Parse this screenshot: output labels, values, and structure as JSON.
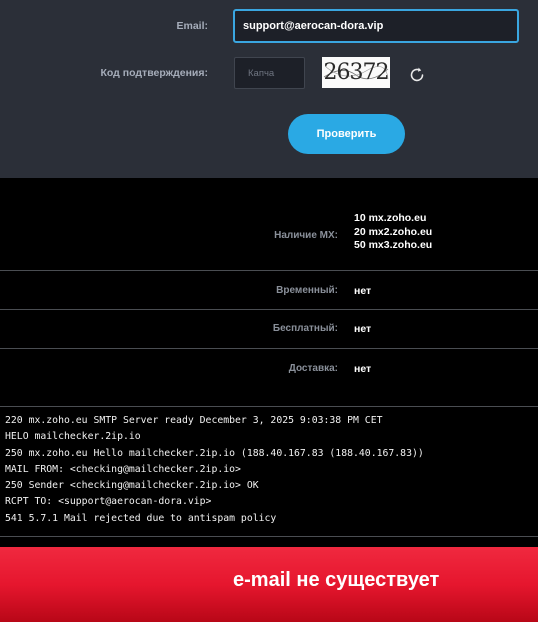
{
  "form": {
    "email_label": "Email:",
    "email_value": "support@aerocan-dora.vip",
    "code_label": "Код подтверждения:",
    "captcha_placeholder": "Капча",
    "captcha_text": "26372",
    "check_button": "Проверить"
  },
  "results": {
    "mx_label": "Наличие MX:",
    "mx_records": [
      "10 mx.zoho.eu",
      "20 mx2.zoho.eu",
      "50 mx3.zoho.eu"
    ],
    "temporary_label": "Временный:",
    "temporary_value": "нет",
    "free_label": "Бесплатный:",
    "free_value": "нет",
    "delivery_label": "Доставка:",
    "delivery_value": "нет"
  },
  "log": [
    "220 mx.zoho.eu SMTP Server ready December 3, 2025 9:03:38 PM CET",
    "HELO mailchecker.2ip.io",
    "250 mx.zoho.eu Hello mailchecker.2ip.io (188.40.167.83 (188.40.167.83))",
    "MAIL FROM: <checking@mailchecker.2ip.io>",
    "250 Sender <checking@mailchecker.2ip.io> OK",
    "RCPT TO: <support@aerocan-dora.vip>",
    "541 5.7.1 Mail rejected due to antispam policy"
  ],
  "banner": {
    "text": "e-mail не существует"
  },
  "icons": {
    "refresh": "refresh-icon"
  },
  "colors": {
    "accent": "#2aa9e4",
    "panel_bg": "#2b2f38",
    "error_banner": "#e6162e"
  }
}
